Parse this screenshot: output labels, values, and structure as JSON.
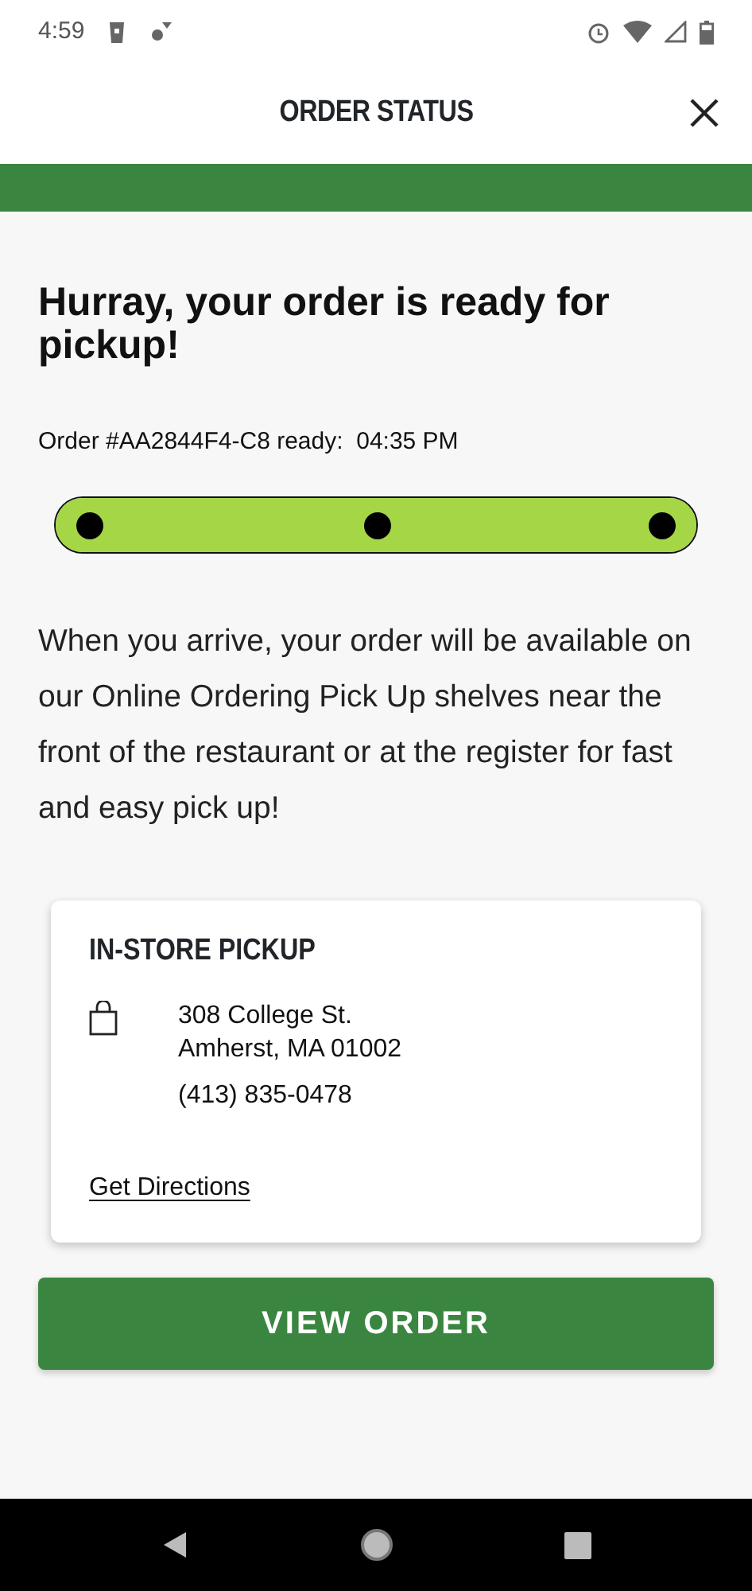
{
  "status_bar": {
    "time": "4:59"
  },
  "header": {
    "title": "ORDER STATUS"
  },
  "heading": "Hurray, your order is ready for pickup!",
  "order_line": "Order #AA2844F4-C8 ready:  04:35 PM",
  "progress": {
    "level": 1
  },
  "message": "When you arrive, your order will be available on our Online Ordering Pick Up shelves near the front of the restaurant or at the register for fast and easy pick up!",
  "pickup_card": {
    "title": "IN-STORE PICKUP",
    "address_lines": [
      "308 College St.",
      "Amherst, MA 01002"
    ],
    "phone": "(413) 835-0478",
    "link": "Get Directions"
  },
  "button": "VIEW ORDER"
}
